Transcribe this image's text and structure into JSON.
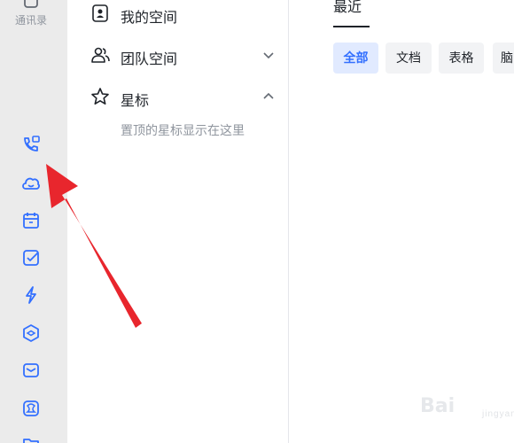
{
  "rail": {
    "contacts_label": "通讯录",
    "accent": "#3370ff",
    "items": [
      {
        "icon": "phone-share-icon"
      },
      {
        "icon": "cloud-icon"
      },
      {
        "icon": "calendar-icon"
      },
      {
        "icon": "task-check-icon"
      },
      {
        "icon": "lightning-icon"
      },
      {
        "icon": "workplace-hexagon-icon"
      },
      {
        "icon": "mail-icon"
      },
      {
        "icon": "minutes-icon"
      },
      {
        "icon": "folder-icon"
      }
    ]
  },
  "nav": {
    "my_space": "我的空间",
    "team_space": "团队空间",
    "starred": "星标",
    "starred_empty": "置顶的星标显示在这里"
  },
  "main": {
    "tab_recent": "最近",
    "filters": [
      {
        "label": "全部",
        "active": true
      },
      {
        "label": "文档",
        "active": false
      },
      {
        "label": "表格",
        "active": false
      },
      {
        "label": "脑",
        "active": false
      }
    ]
  },
  "annotation": {
    "arrow_color": "#e8262d"
  },
  "watermark": {
    "text": "Bai",
    "sub": "jingyan"
  }
}
